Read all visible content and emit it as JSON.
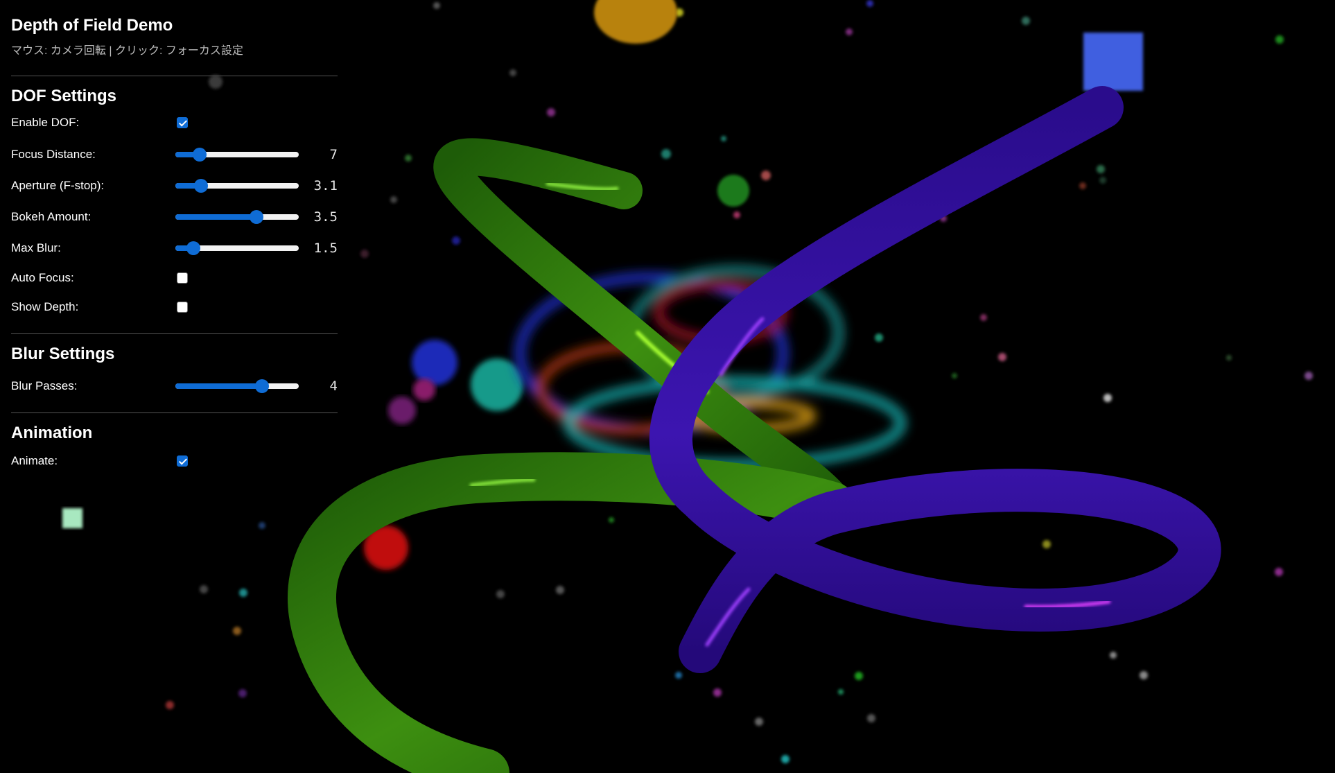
{
  "app": {
    "title": "Depth of Field Demo",
    "subtitle": "マウス: カメラ回転 | クリック: フォーカス設定"
  },
  "sections": {
    "dof": {
      "title": "DOF Settings",
      "enable_dof": {
        "label": "Enable DOF:",
        "checked": true
      },
      "focus_distance": {
        "label": "Focus Distance:",
        "value": "7",
        "fraction": 0.16
      },
      "aperture": {
        "label": "Aperture (F-stop):",
        "value": "3.1",
        "fraction": 0.17
      },
      "bokeh_amount": {
        "label": "Bokeh Amount:",
        "value": "3.5",
        "fraction": 0.68
      },
      "max_blur": {
        "label": "Max Blur:",
        "value": "1.5",
        "fraction": 0.1
      },
      "auto_focus": {
        "label": "Auto Focus:",
        "checked": false
      },
      "show_depth": {
        "label": "Show Depth:",
        "checked": false
      }
    },
    "blur": {
      "title": "Blur Settings",
      "blur_passes": {
        "label": "Blur Passes:",
        "value": "4",
        "fraction": 0.73
      }
    },
    "animation": {
      "title": "Animation",
      "animate": {
        "label": "Animate:",
        "checked": true
      }
    }
  },
  "colors": {
    "accent": "#0f6cd5",
    "background": "#000000",
    "helix_green": "#2f7d0d",
    "helix_purple": "#3a12a8"
  }
}
